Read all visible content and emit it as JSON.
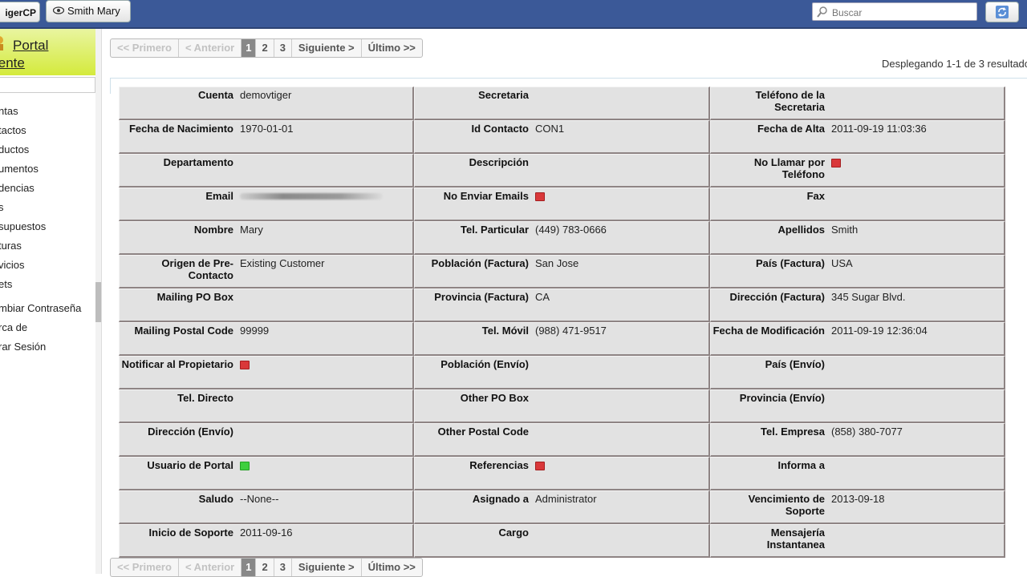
{
  "topbar": {
    "logo_text": "igerCP",
    "user_name": "Smith Mary",
    "search_placeholder": "Buscar"
  },
  "sidebar": {
    "title_line1": "Portal",
    "title_line2": "iente",
    "items": [
      "ntas",
      "tactos",
      "ductos",
      "umentos",
      "dencias",
      "s",
      "supuestos",
      "turas",
      "vicios",
      "ets",
      "mbiar Contraseña",
      "rca de",
      "rar Sesión"
    ]
  },
  "pagination": {
    "first": "<< Primero",
    "prev": "< Anterior",
    "pages": [
      "1",
      "2",
      "3"
    ],
    "current_page": "1",
    "next": "Siguiente >",
    "last": "Último >>"
  },
  "result_count": "Desplegando 1-1 de 3 resultado",
  "fields": [
    {
      "label": "Cuenta",
      "value": "demovtiger"
    },
    {
      "label": "Secretaria",
      "value": ""
    },
    {
      "label": "Teléfono de la Secretaria",
      "value": ""
    },
    {
      "label": "Fecha de Nacimiento",
      "value": "1970-01-01"
    },
    {
      "label": "Id Contacto",
      "value": "CON1"
    },
    {
      "label": "Fecha de Alta",
      "value": "2011-09-19 11:03:36"
    },
    {
      "label": "Departamento",
      "value": ""
    },
    {
      "label": "Descripción",
      "value": ""
    },
    {
      "label": "No Llamar por Teléfono",
      "value": "",
      "flag": "red"
    },
    {
      "label": "Email",
      "value": "",
      "blurred": true
    },
    {
      "label": "No Enviar Emails",
      "value": "",
      "flag": "red"
    },
    {
      "label": "Fax",
      "value": ""
    },
    {
      "label": "Nombre",
      "value": "Mary"
    },
    {
      "label": "Tel. Particular",
      "value": "(449) 783-0666"
    },
    {
      "label": "Apellidos",
      "value": "Smith"
    },
    {
      "label": "Origen de Pre-Contacto",
      "value": "Existing Customer"
    },
    {
      "label": "Población (Factura)",
      "value": "San Jose"
    },
    {
      "label": "País (Factura)",
      "value": "USA"
    },
    {
      "label": "Mailing PO Box",
      "value": ""
    },
    {
      "label": "Provincia (Factura)",
      "value": "CA"
    },
    {
      "label": "Dirección (Factura)",
      "value": "345 Sugar Blvd."
    },
    {
      "label": "Mailing Postal Code",
      "value": "99999"
    },
    {
      "label": "Tel. Móvil",
      "value": "(988) 471-9517"
    },
    {
      "label": "Fecha de Modificación",
      "value": "2011-09-19 12:36:04"
    },
    {
      "label": "Notificar al Propietario",
      "value": "",
      "flag": "red"
    },
    {
      "label": "Población (Envío)",
      "value": ""
    },
    {
      "label": "País (Envío)",
      "value": ""
    },
    {
      "label": "Tel. Directo",
      "value": ""
    },
    {
      "label": "Other PO Box",
      "value": ""
    },
    {
      "label": "Provincia (Envío)",
      "value": ""
    },
    {
      "label": "Dirección (Envío)",
      "value": ""
    },
    {
      "label": "Other Postal Code",
      "value": ""
    },
    {
      "label": "Tel. Empresa",
      "value": "(858) 380-7077"
    },
    {
      "label": "Usuario de Portal",
      "value": "",
      "flag": "green"
    },
    {
      "label": "Referencias",
      "value": "",
      "flag": "red"
    },
    {
      "label": "Informa a",
      "value": ""
    },
    {
      "label": "Saludo",
      "value": "--None--"
    },
    {
      "label": "Asignado a",
      "value": "Administrator"
    },
    {
      "label": "Vencimiento de Soporte",
      "value": "2013-09-18"
    },
    {
      "label": "Inicio de Soporte",
      "value": "2011-09-16"
    },
    {
      "label": "Cargo",
      "value": ""
    },
    {
      "label": "Mensajería Instantanea",
      "value": ""
    }
  ],
  "colors": {
    "topbar": "#3b5998",
    "cell_bg": "#e2e2e2",
    "cell_border": "#8e8484",
    "flag_red": "#d9383a",
    "flag_green": "#3fcf3f",
    "sidebar_header": "#d4ea3c"
  }
}
